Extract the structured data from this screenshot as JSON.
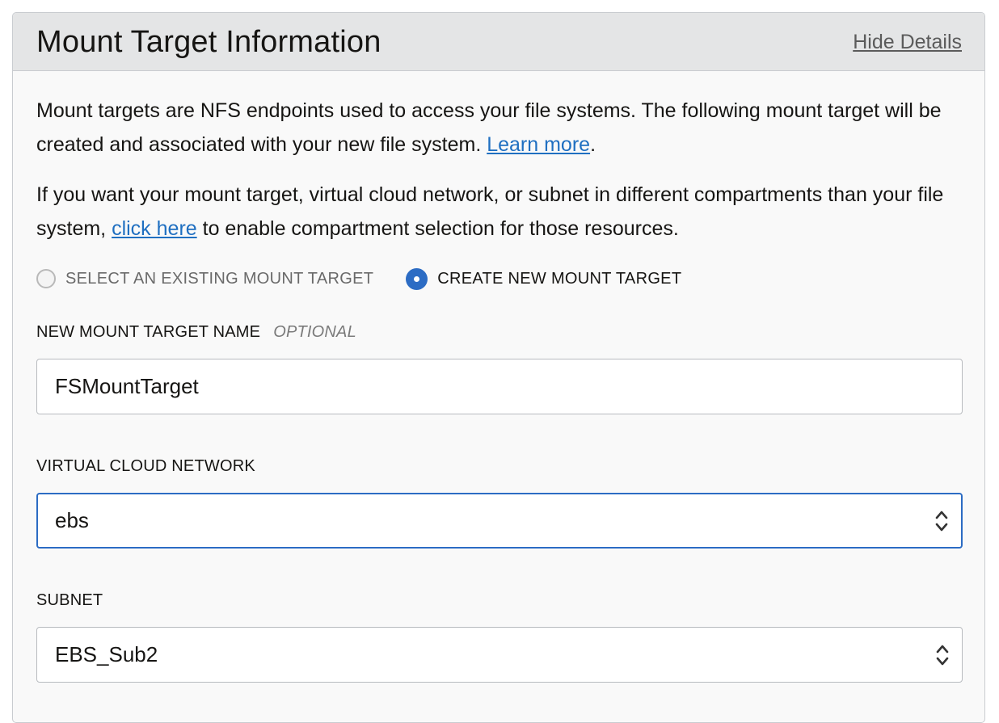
{
  "panel": {
    "title": "Mount Target Information",
    "hide_details": "Hide Details"
  },
  "intro": {
    "para1_text": "Mount targets are NFS endpoints used to access your file systems. The following mount target will be created and associated with your new file system. ",
    "para1_link": "Learn more",
    "para1_end": ".",
    "para2_start": "If you want your mount target, virtual cloud network, or subnet in different compartments than your file system, ",
    "para2_link": "click here",
    "para2_end": " to enable compartment selection for those resources."
  },
  "mode": {
    "options": [
      {
        "label": "SELECT AN EXISTING MOUNT TARGET",
        "selected": false
      },
      {
        "label": "CREATE NEW MOUNT TARGET",
        "selected": true
      }
    ]
  },
  "fields": {
    "name_label": "NEW MOUNT TARGET NAME",
    "name_optional": "OPTIONAL",
    "name_value": "FSMountTarget",
    "vcn_label": "VIRTUAL CLOUD NETWORK",
    "vcn_value": "ebs",
    "subnet_label": "SUBNET",
    "subnet_value": "EBS_Sub2"
  },
  "colors": {
    "accent": "#2c6cc4",
    "link": "#1f6fc1",
    "header_bg": "#e4e5e6"
  }
}
